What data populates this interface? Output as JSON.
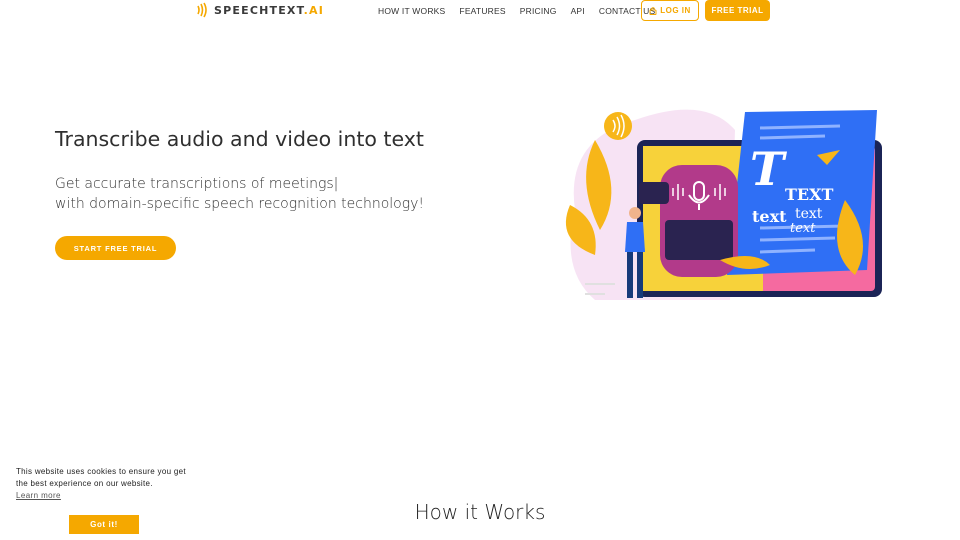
{
  "header": {
    "logo_text": "SPEECHTEXT",
    "logo_suffix": ".AI",
    "nav": [
      {
        "label": "HOW IT WORKS"
      },
      {
        "label": "FEATURES"
      },
      {
        "label": "PRICING"
      },
      {
        "label": "API"
      },
      {
        "label": "CONTACT US"
      }
    ],
    "login_label": "LOG IN",
    "trial_label": "FREE TRIAL"
  },
  "hero": {
    "title": "Transcribe audio and video into text",
    "subtitle_line1": "Get accurate transcriptions of meetings|",
    "subtitle_line2": "with domain-specific speech recognition technology!",
    "cta_label": "START FREE TRIAL",
    "illustration_text_big": "T",
    "illustration_text1": "TEXT",
    "illustration_text2": "text",
    "illustration_text3": "text",
    "illustration_text4": "text"
  },
  "cookie": {
    "text": "This website uses cookies to ensure you get the best experience on our website.",
    "link_label": "Learn more",
    "button_label": "Got it!"
  },
  "section": {
    "title": "How it Works"
  },
  "colors": {
    "accent": "#f5a800",
    "blue": "#2f6ff5",
    "purple": "#b23a8a"
  }
}
